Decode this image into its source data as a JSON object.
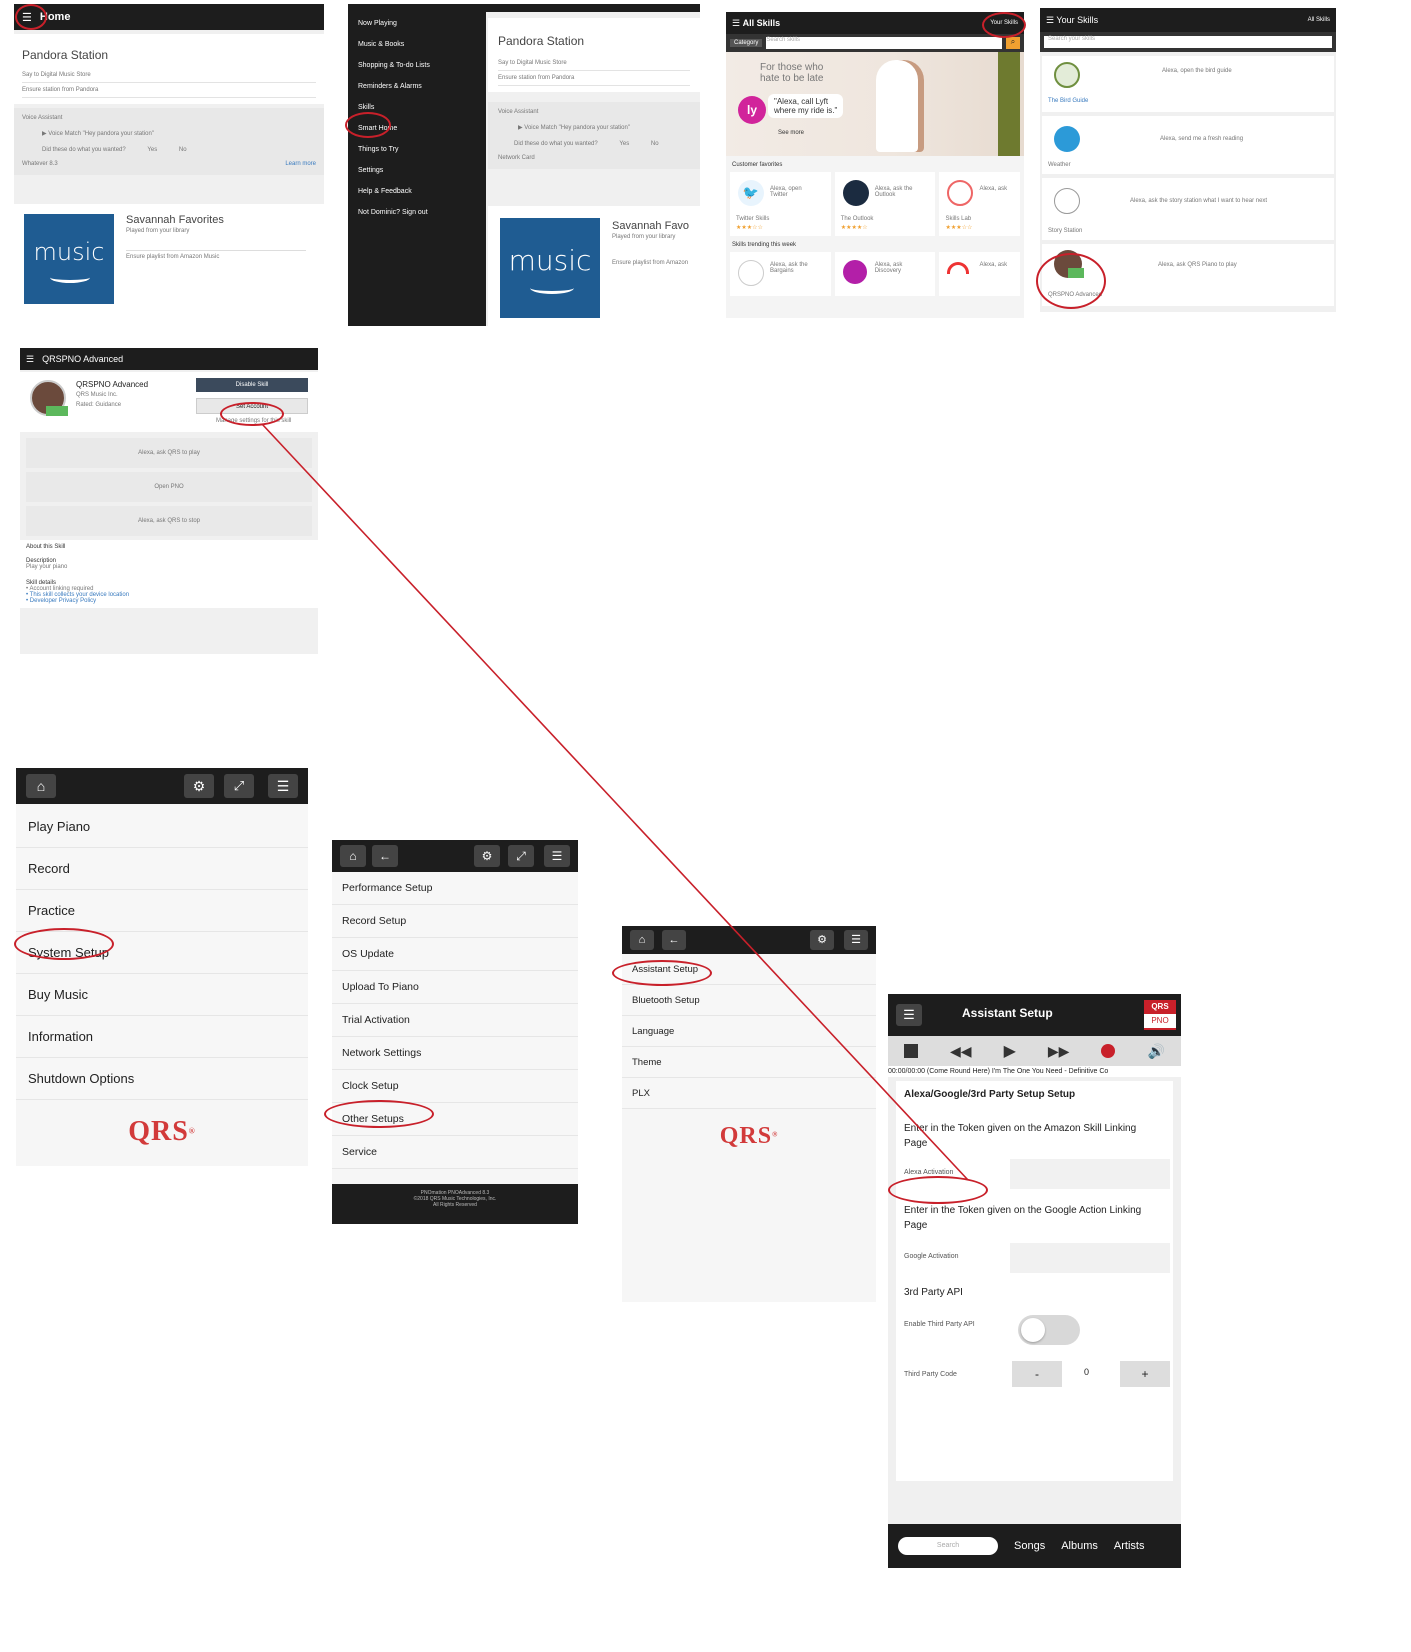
{
  "panel1": {
    "title": "Home",
    "card_title": "Pandora Station",
    "rows": [
      "Say to Digital Music Store",
      "Ensure station from Pandora"
    ],
    "section": "Voice Assistant",
    "item": "Voice Match \"Hey pandora your station\"",
    "question": "Did these do what you wanted?",
    "yes": "Yes",
    "no": "No",
    "footer_left": "Whatever 8.3",
    "footer_right": "Learn more",
    "music_card": {
      "title": "Savannah Favorites",
      "sub": "Played from your library",
      "desc": "Ensure playlist from Amazon Music",
      "logo_word": "music"
    }
  },
  "panel2": {
    "menu": [
      "Now Playing",
      "Music & Books",
      "Shopping & To-do Lists",
      "Reminders & Alarms",
      "Skills",
      "Smart Home",
      "Things to Try",
      "Settings",
      "Help & Feedback",
      "Not Dominic? Sign out"
    ],
    "card_title": "Pandora Station",
    "rows": [
      "Say to Digital Music Store",
      "Ensure station from Pandora"
    ],
    "section": "Voice Assistant",
    "item": "Voice Match \"Hey pandora your station\"",
    "question": "Did these do what you wanted?",
    "yes": "Yes",
    "no": "No",
    "footer_row": "Network Card",
    "music_card": {
      "title": "Savannah Favo",
      "sub": "Played from your library",
      "desc": "Ensure playlist from Amazon",
      "logo_word": "music"
    }
  },
  "panel3": {
    "title": "All Skills",
    "your_skills": "Your Skills",
    "category": "Category",
    "search_placeholder": "Search skills",
    "banner_line1": "For those who",
    "banner_line2": "hate to be late",
    "banner_quote_1": "\"Alexa, call Lyft",
    "banner_quote_2": "where my ride is.\"",
    "banner_cta": "See more",
    "section1": "Customer favorites",
    "skills1": [
      {
        "name": "Alexa, open Twitter",
        "meta": "Twitter Skills"
      },
      {
        "name": "Alexa, ask the Outlook",
        "meta": "The Outlook"
      },
      {
        "name": "Alexa, ask",
        "meta": "Skills Lab"
      }
    ],
    "section2": "Skills trending this week",
    "skills2": [
      {
        "name": "Alexa, ask the Bargains"
      },
      {
        "name": "Alexa, ask Discovery"
      },
      {
        "name": "Alexa, ask"
      }
    ]
  },
  "panel4": {
    "title": "Your Skills",
    "edit": "All Skills",
    "search_placeholder": "Search your skills",
    "items": [
      {
        "quote": "Alexa, open the bird guide",
        "label": "The Bird Guide"
      },
      {
        "quote": "Alexa, send me a fresh reading",
        "label": "Weather"
      },
      {
        "quote": "Alexa, ask the story station what I want to hear next",
        "label": "Story Station"
      },
      {
        "quote": "Alexa, ask QRS Piano to play",
        "label": "QRSPNO Advanced"
      }
    ]
  },
  "panel5": {
    "title": "QRSPNO Advanced",
    "app_name": "QRSPNO Advanced",
    "dev": "QRS Music Inc.",
    "rated": "Rated: Guidance",
    "enable_btn": "Disable Skill",
    "settings_btn": "Set Account",
    "settings_sub": "Manage settings for this skill",
    "phrases": [
      "Alexa, ask QRS to play",
      "Open PNO",
      "Alexa, ask QRS to stop"
    ],
    "about": "About this Skill",
    "desc_label": "Description",
    "desc_text": "Play your piano",
    "skill_label": "Skill details",
    "bullets": [
      "Account linking required",
      "This skill collects your device location",
      "Developer Privacy Policy"
    ]
  },
  "panel6": {
    "items": [
      "Play Piano",
      "Record",
      "Practice",
      "System Setup",
      "Buy Music",
      "Information",
      "Shutdown Options"
    ],
    "logo": "QRS",
    "logo_mark": "®"
  },
  "panel7": {
    "items": [
      "Performance Setup",
      "Record Setup",
      "OS Update",
      "Upload To Piano",
      "Trial Activation",
      "Network Settings",
      "Clock Setup",
      "Other Setups",
      "Service"
    ],
    "footer": [
      "PNOmation PNOAdvanced 8.3",
      "©2018 QRS Music Technologies, Inc.",
      "All Rights Reserved"
    ]
  },
  "panel8": {
    "items": [
      "Assistant Setup",
      "Bluetooth Setup",
      "Language",
      "Theme",
      "PLX"
    ],
    "logo": "QRS",
    "logo_mark": "®"
  },
  "panel9": {
    "title": "Assistant Setup",
    "badge_top": "QRS",
    "badge_bottom": "PNO",
    "now_playing": "00:00/00:00 (Come Round Here) I'm The One You Need - Definitive Co",
    "heading": "Alexa/Google/3rd Party Setup Setup",
    "alexa_text": "Enter in the Token given on the Amazon Skill Linking Page",
    "alexa_label": "Alexa Activation",
    "google_text": "Enter in the Token given on the Google Action Linking Page",
    "google_label": "Google Activation",
    "third_party": "3rd Party API",
    "enable_label": "Enable Third Party API",
    "port_label": "Third Party Code",
    "port_value": "0",
    "minus": "-",
    "plus": "+",
    "search_placeholder": "Search",
    "tabs": [
      "Songs",
      "Albums",
      "Artists"
    ]
  },
  "colors": {
    "accent": "#c8202a",
    "header": "#1d1d1d",
    "alexa_blue": "#1f5c92"
  }
}
